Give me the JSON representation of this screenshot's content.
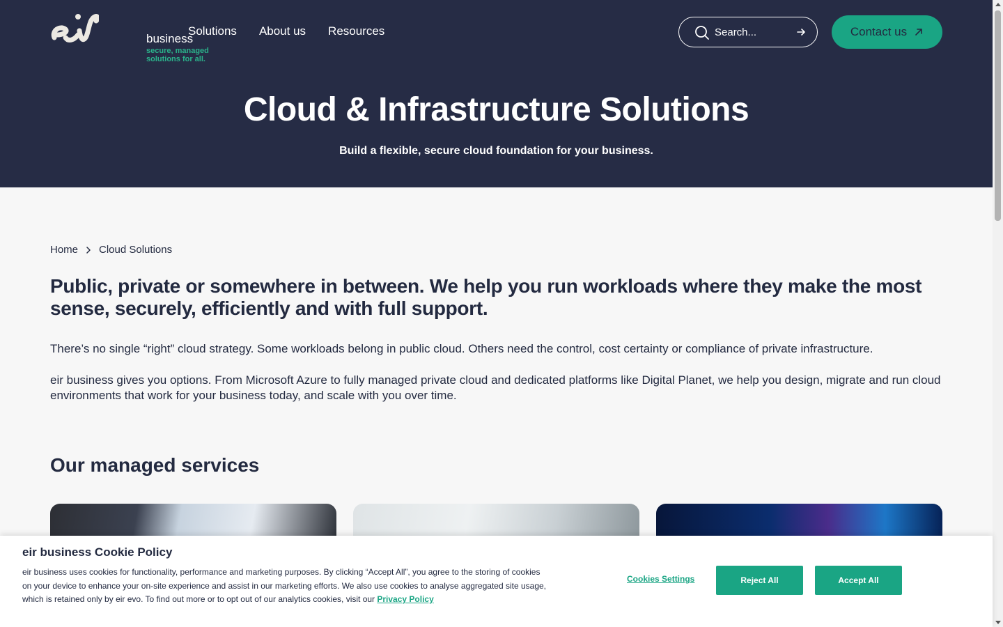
{
  "brand": {
    "logo_script": "eir",
    "word": "business",
    "tagline": "secure, managed solutions for all.",
    "colors": {
      "navy": "#262c45",
      "green": "#1aa584"
    }
  },
  "nav": {
    "items": [
      {
        "label": "Solutions"
      },
      {
        "label": "About us"
      },
      {
        "label": "Resources"
      }
    ]
  },
  "search": {
    "placeholder": "Search..."
  },
  "contact": {
    "label": "Contact us"
  },
  "hero": {
    "title": "Cloud & Infrastructure Solutions",
    "subtitle": "Build a flexible, secure cloud foundation for your business."
  },
  "breadcrumb": {
    "home": "Home",
    "current": "Cloud Solutions"
  },
  "intro": {
    "lead": "Public, private or somewhere in between. We help you run workloads where they make the most sense, securely, efficiently and with full support.",
    "p1": "There’s no single “right” cloud strategy. Some workloads belong in public cloud. Others need the control, cost certainty or compliance of private infrastructure.",
    "p2": "eir business gives you options. From Microsoft Azure to fully managed private cloud and dedicated platforms like Digital Planet, we help you design, migrate and run cloud environments that work for your business today, and scale with you over time."
  },
  "services": {
    "title": "Our managed services"
  },
  "cookie": {
    "title": "eir business Cookie Policy",
    "text": "eir business uses cookies for functionality, performance and marketing purposes. By clicking “Accept All”, you agree to the storing of cookies on your device to enhance your on-site experience and assist in our marketing efforts. We also use cookies to analyse aggregated site usage, which is retained only by eir evo. To find out more or to opt out of our analytics cookies, visit our ",
    "privacy_link": "Privacy Policy",
    "settings": "Cookies Settings",
    "reject": "Reject All",
    "accept": "Accept All"
  }
}
